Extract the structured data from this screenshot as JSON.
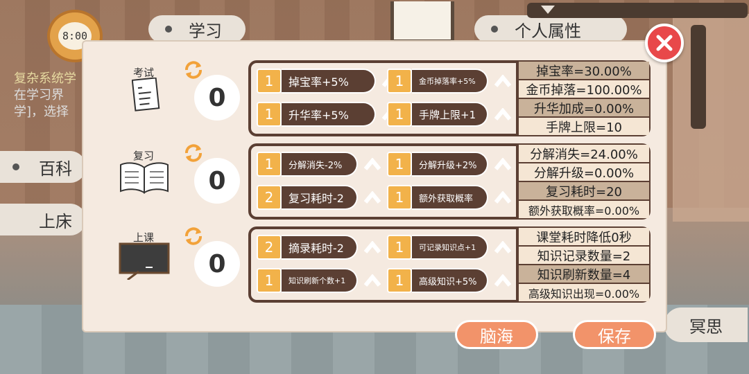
{
  "background": {
    "clock_time": "8:00",
    "top_tab_study": "学习",
    "top_tab_attributes": "个人属性",
    "side_encyclopedia": "百科",
    "side_bed": "上床",
    "hint_line1": "复杂系统学",
    "hint_line2": "在学习界",
    "hint_line3": "学]，选择",
    "meditate_label": "冥思"
  },
  "sections": [
    {
      "label": "考试",
      "icon": "exam-paper-icon",
      "points": "0",
      "upgrades": [
        {
          "level": "1",
          "name": "掉宝率+5%"
        },
        {
          "level": "1",
          "name": "金币掉落率+5%"
        },
        {
          "level": "1",
          "name": "升华率+5%"
        },
        {
          "level": "1",
          "name": "手牌上限+1"
        }
      ],
      "stats": [
        "掉宝率=30.00%",
        "金币掉落=100.00%",
        "升华加成=0.00%",
        "手牌上限=10"
      ]
    },
    {
      "label": "复习",
      "icon": "open-book-icon",
      "points": "0",
      "upgrades": [
        {
          "level": "1",
          "name": "分解消失-2%"
        },
        {
          "level": "1",
          "name": "分解升级+2%"
        },
        {
          "level": "2",
          "name": "复习耗时-2"
        },
        {
          "level": "1",
          "name": "额外获取概率"
        }
      ],
      "stats": [
        "分解消失=24.00%",
        "分解升级=0.00%",
        "复习耗时=20",
        "额外获取概率=0.00%"
      ]
    },
    {
      "label": "上课",
      "icon": "blackboard-icon",
      "points": "0",
      "upgrades": [
        {
          "level": "2",
          "name": "摘录耗时-2"
        },
        {
          "level": "1",
          "name": "可记录知识点+1"
        },
        {
          "level": "1",
          "name": "知识刷新个数+1"
        },
        {
          "level": "1",
          "name": "高级知识+5%"
        }
      ],
      "stats": [
        "课堂耗时降低0秒",
        "知识记录数量=2",
        "知识刷新数量=4",
        "高级知识出现=0.00%"
      ]
    }
  ],
  "buttons": {
    "brain": "脑海",
    "save": "保存"
  },
  "colors": {
    "panel_bg": "#f5eae0",
    "box_dark": "#5b3f33",
    "level_orange": "#f2b24a",
    "button_orange": "#f2936a",
    "close_red": "#e8484a"
  }
}
